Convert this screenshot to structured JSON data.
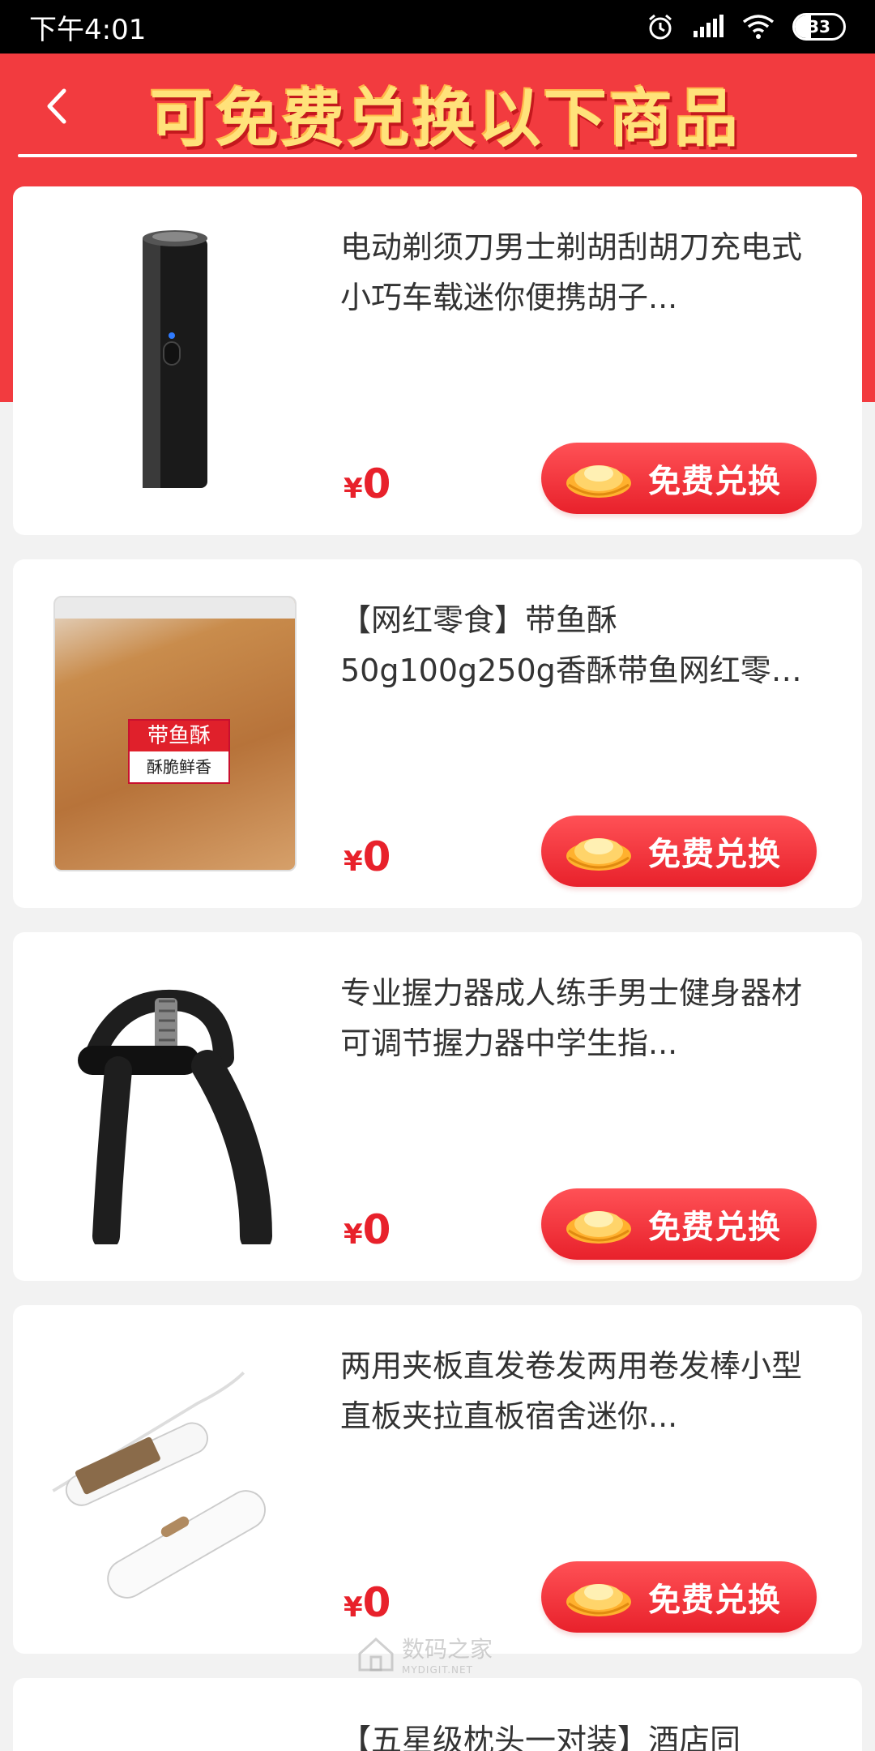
{
  "status_bar": {
    "time": "下午4:01",
    "battery": "33",
    "battery_level": 0.33
  },
  "header": {
    "title": "可免费兑换以下商品",
    "back_icon": "chevron-left-icon"
  },
  "products": [
    {
      "title": "电动剃须刀男士剃胡刮胡刀充电式小巧车载迷你便携胡子...",
      "currency": "¥",
      "price": "0",
      "button_label": "免费兑换",
      "thumbnail": "electric-shaver"
    },
    {
      "title": "【网红零食】带鱼酥50g100g250g香酥带鱼网红零食干货...",
      "currency": "¥",
      "price": "0",
      "button_label": "免费兑换",
      "thumbnail": "fish-snack-bag",
      "thumb_label_1": "带鱼酥",
      "thumb_label_2": "酥脆鲜香"
    },
    {
      "title": "专业握力器成人练手男士健身器材可调节握力器中学生指...",
      "currency": "¥",
      "price": "0",
      "button_label": "免费兑换",
      "thumbnail": "hand-grip"
    },
    {
      "title": "两用夹板直发卷发两用卷发棒小型直板夹拉直板宿舍迷你...",
      "currency": "¥",
      "price": "0",
      "button_label": "免费兑换",
      "thumbnail": "hair-curler"
    },
    {
      "title": "【五星级枕头一对装】酒店同",
      "thumbnail": "pillow"
    }
  ],
  "watermark": {
    "text": "数码之家",
    "sub": "MYDIGIT.NET"
  },
  "colors": {
    "header_red": "#f23b3f",
    "title_yellow": "#ffe27a",
    "price_red": "#e8212b",
    "page_bg": "#f2f2f2"
  }
}
